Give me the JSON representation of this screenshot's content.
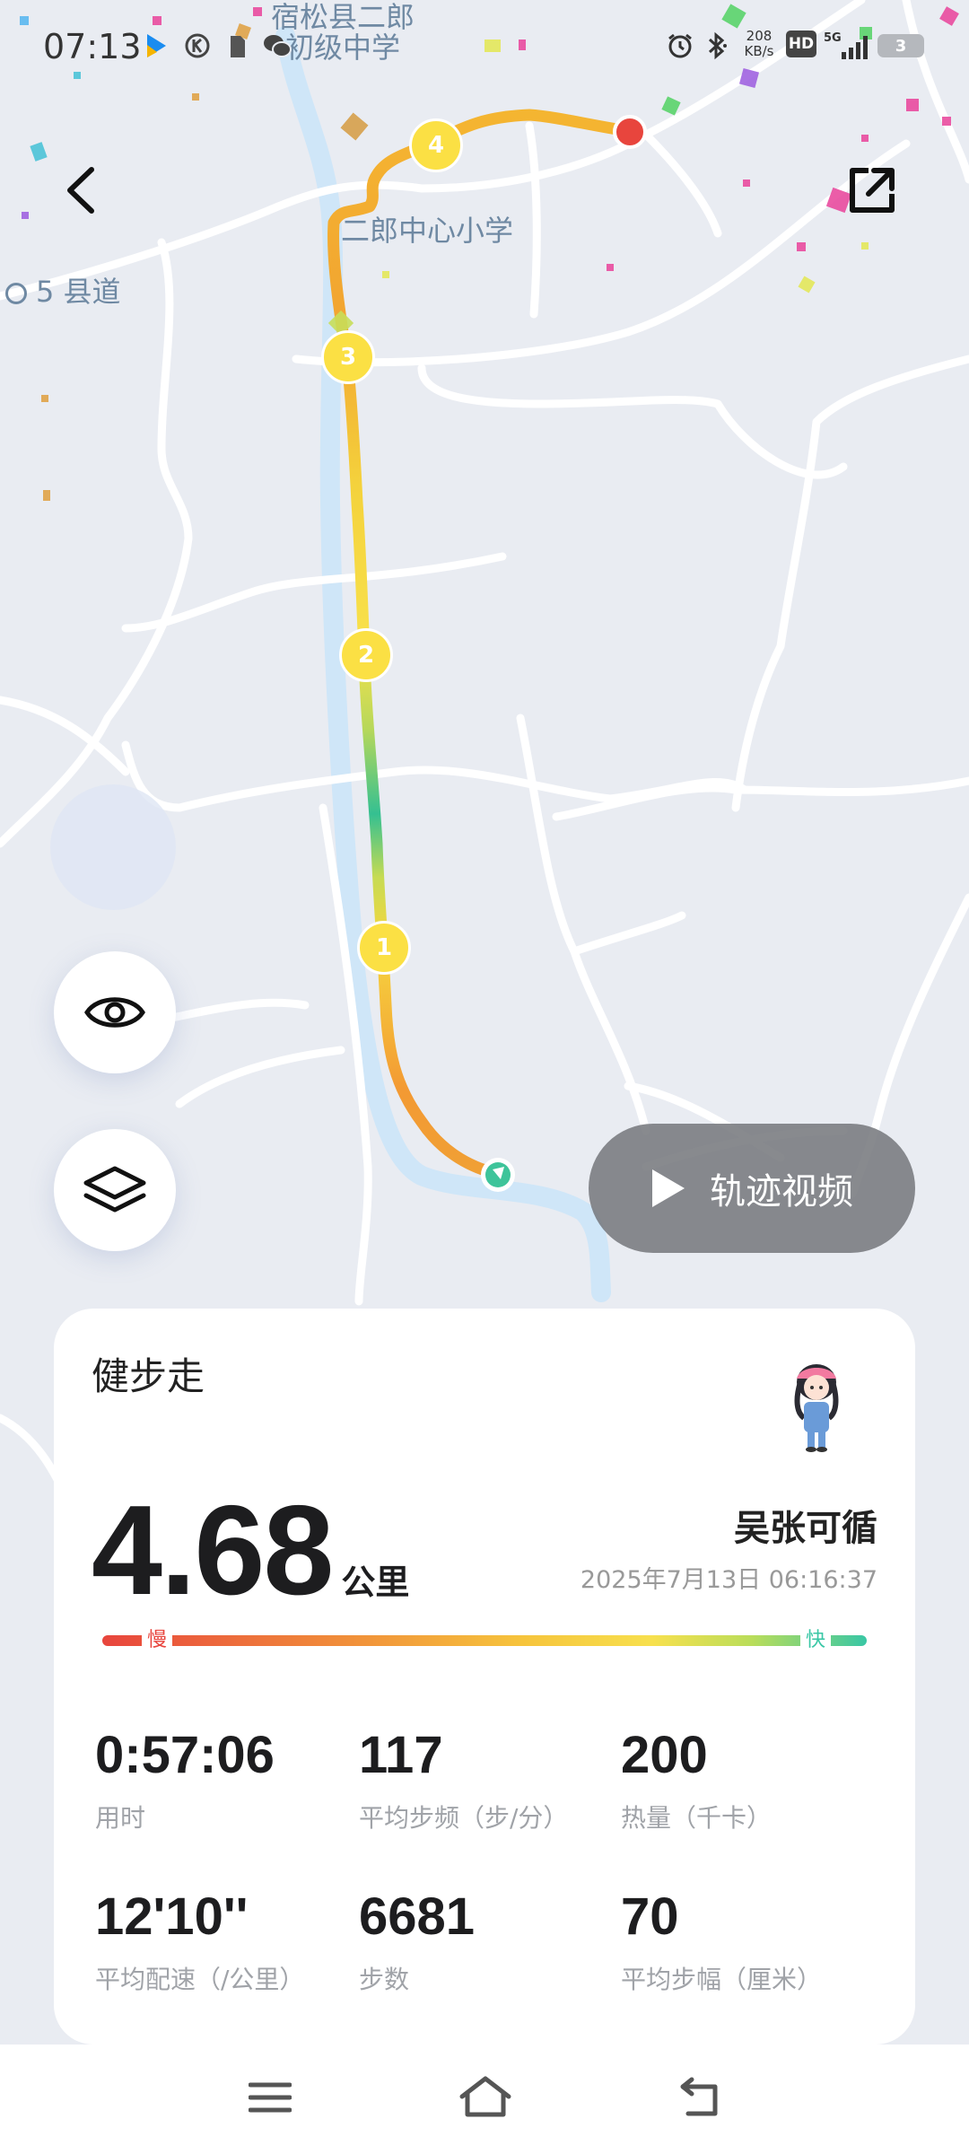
{
  "status_bar": {
    "time": "07:13",
    "net_speed_value": "208",
    "net_speed_unit": "KB/s",
    "battery": "3",
    "hd": "HD",
    "network": "5G",
    "icons": [
      "app-icon",
      "k-icon",
      "sim-icon",
      "wechat-icon",
      "alarm-icon",
      "bluetooth-icon",
      "signal-icon",
      "battery-icon"
    ]
  },
  "map": {
    "place_labels": [
      "宿松县二郎",
      "初级中学",
      "二郎中心小学",
      "5 县道"
    ],
    "markers": [
      "1",
      "2",
      "3",
      "4"
    ]
  },
  "buttons": {
    "back_icon": "chevron-left-icon",
    "share_icon": "share-external-icon",
    "eye_icon": "eye-icon",
    "layers_icon": "layers-icon",
    "video_label": "轨迹视频"
  },
  "card": {
    "activity_type": "健步走",
    "distance": "4.68",
    "distance_unit": "公里",
    "user_name": "吴张可循",
    "timestamp": "2025年7月13日 06:16:37",
    "pace_slow": "慢",
    "pace_fast": "快",
    "stats": [
      {
        "value": "0:57:06",
        "label": "用时"
      },
      {
        "value": "117",
        "label": "平均步频（步/分）"
      },
      {
        "value": "200",
        "label": "热量（千卡）"
      },
      {
        "value": "12'10''",
        "label": "平均配速（/公里）"
      },
      {
        "value": "6681",
        "label": "步数"
      },
      {
        "value": "70",
        "label": "平均步幅（厘米）"
      }
    ]
  },
  "nav": {
    "menu_icon": "menu-icon",
    "home_icon": "home-icon",
    "back_icon": "back-icon"
  },
  "colors": {
    "slow": "#e8453d",
    "fast": "#39c7a5",
    "marker": "#fbe044",
    "end_dot": "#e8453d",
    "start_dot": "#3ec49a"
  }
}
